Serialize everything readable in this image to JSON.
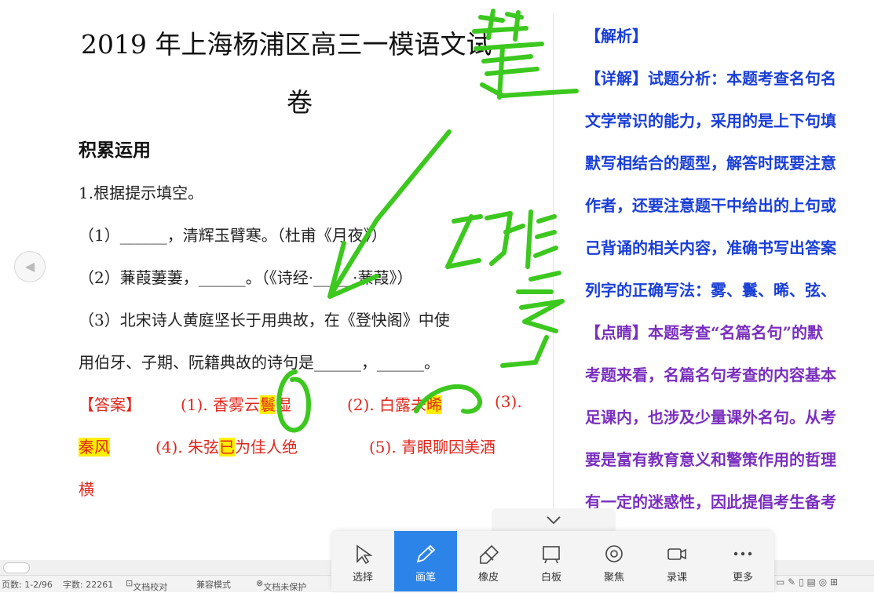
{
  "document": {
    "title_line1": "2019 年上海杨浦区高三一模语文试",
    "title_line2": "卷",
    "section": "积累运用",
    "q1": "1.根据提示填空。",
    "q1_1": "（1）______，清辉玉臂寒。（杜甫《月夜》）",
    "q1_2": "（2）蒹葭萋萋，______。（《诗经·_____·蒹葭》）",
    "q1_3a": "（3）北宋诗人黄庭坚长于用典故，在《登快阁》中使",
    "q1_3b": "用伯牙、子期、阮籍典故的诗句是______，______。",
    "answer_label": "【答案】",
    "a1_pre": "(1). 香雾云",
    "a1_hl": "鬟",
    "a1_post": "湿",
    "a2_pre": "(2). 白露未",
    "a2_hl": "晞",
    "a3": "(3).",
    "a3_hl": "秦风",
    "a4_pre": "(4). 朱弦",
    "a4_hl": "已",
    "a4_post": "为佳人绝",
    "a5": "(5). 青眼聊因美酒",
    "a5_cont": "横"
  },
  "analysis": {
    "l1": "【解析】",
    "l2": "【详解】试题分析：本题考查名句名",
    "l3": "文学常识的能力，采用的是上下句填",
    "l4": "默写相结合的题型，解答时既要注意",
    "l5": "作者，还要注意题干中给出的上句或",
    "l6": "己背诵的相关内容，准确书写出答案",
    "l7": "列字的正确写法：雾、鬟、晞、弦、",
    "l8": "【点睛】本题考查“名篇名句”的默",
    "l9": "考题来看，名篇名句考查的内容基本",
    "l10": "足课内，也涉及少量课外名句。从考",
    "l11": "要是富有教育意义和警策作用的哲理",
    "l12": "有一定的迷惑性，因此提倡考生备考"
  },
  "toolbar": {
    "tools": [
      {
        "label": "选择",
        "icon": "cursor-icon"
      },
      {
        "label": "画笔",
        "icon": "pen-icon"
      },
      {
        "label": "橡皮",
        "icon": "eraser-icon"
      },
      {
        "label": "白板",
        "icon": "whiteboard-icon"
      },
      {
        "label": "聚焦",
        "icon": "focus-icon"
      },
      {
        "label": "录课",
        "icon": "record-icon"
      },
      {
        "label": "更多",
        "icon": "more-icon"
      }
    ],
    "active": "画笔",
    "ink_color": "#3cc81e",
    "accent_color": "#2d84e8"
  },
  "status": {
    "pages": "页数: 1-2/96",
    "words": "字数: 22261",
    "proofread": "文档校对",
    "compat": "兼容模式",
    "protect": "文档未保护"
  }
}
